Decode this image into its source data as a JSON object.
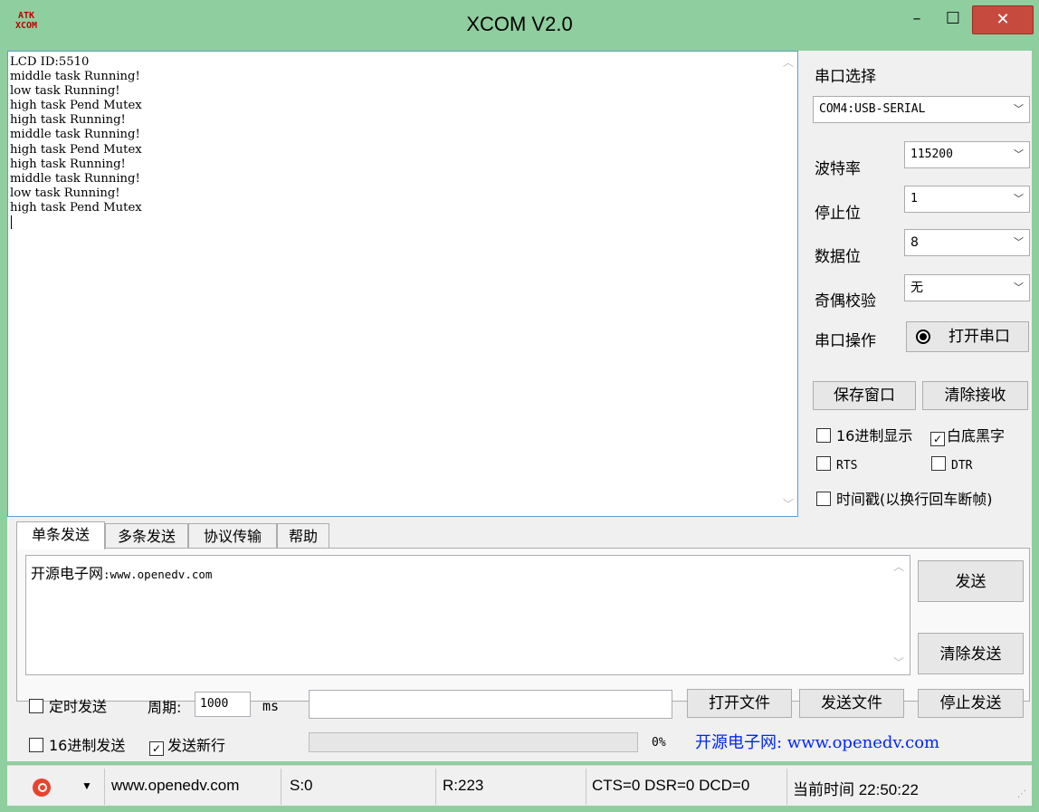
{
  "window": {
    "title": "XCOM V2.0",
    "icon_text": "ATK XCOM",
    "minimize_glyph": "–",
    "maximize_glyph": "☐",
    "close_glyph": "✕"
  },
  "receive": {
    "lines": [
      "LCD ID:5510",
      "middle task Running!",
      "low task Running!",
      "high task Pend Mutex",
      "high task Running!",
      "middle task Running!",
      "high task Pend Mutex",
      "high task Running!",
      "middle task Running!",
      "low task Running!",
      "high task Pend Mutex"
    ]
  },
  "side": {
    "port_label": "串口选择",
    "port_value": "COM4:USB-SERIAL",
    "baud_label": "波特率",
    "baud_value": "115200",
    "stop_label": "停止位",
    "stop_value": "1",
    "data_label": "数据位",
    "data_value": "8",
    "parity_label": "奇偶校验",
    "parity_value": "无",
    "op_label": "串口操作",
    "open_port_label": "打开串口",
    "save_window_label": "保存窗口",
    "clear_receive_label": "清除接收",
    "hex_display_label": "16进制显示",
    "hex_display_checked": false,
    "white_bg_label": "白底黑字",
    "white_bg_checked": true,
    "rts_label": "RTS",
    "rts_checked": false,
    "dtr_label": "DTR",
    "dtr_checked": false,
    "timestamp_label": "时间戳(以换行回车断帧)",
    "timestamp_checked": false
  },
  "tabs": [
    {
      "label": "单条发送",
      "active": true
    },
    {
      "label": "多条发送",
      "active": false
    },
    {
      "label": "协议传输",
      "active": false
    },
    {
      "label": "帮助",
      "active": false
    }
  ],
  "send": {
    "text_cn": "开源电子网",
    "text_url": ":www.openedv.com",
    "send_label": "发送",
    "clear_send_label": "清除发送",
    "timed_send_label": "定时发送",
    "timed_send_checked": false,
    "period_label": "周期:",
    "period_value": "1000",
    "period_unit": "ms",
    "open_file_label": "打开文件",
    "send_file_label": "发送文件",
    "stop_send_label": "停止发送",
    "hex_send_label": "16进制发送",
    "hex_send_checked": false,
    "newline_label": "发送新行",
    "newline_checked": true,
    "progress_percent": 0,
    "progress_text": "0%",
    "ad_text": "开源电子网: www.openedv.com"
  },
  "status": {
    "dropdown_glyph": "▼",
    "url": "www.openedv.com",
    "sent": "S:0",
    "received": "R:223",
    "lines": "CTS=0 DSR=0 DCD=0",
    "time": "当前时间 22:50:22"
  },
  "colors": {
    "frame": "#8fce9f",
    "close": "#c74a3f",
    "accent_border": "#5b9bd5",
    "link": "#0026ff"
  }
}
